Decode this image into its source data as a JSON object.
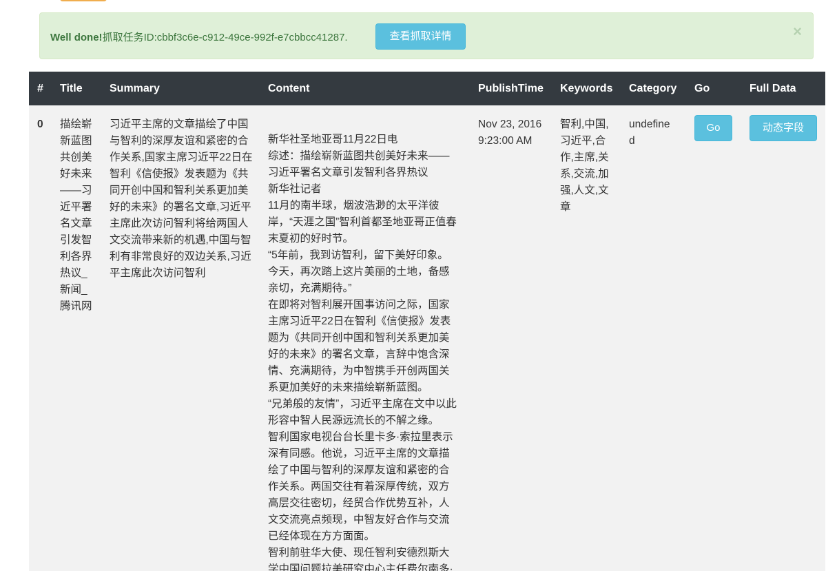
{
  "alert": {
    "strong": "Well done!",
    "message": "抓取任务ID:cbbf3c6e-c912-49ce-992f-e7cbbcc41287.",
    "button_label": "查看抓取详情",
    "close": "×"
  },
  "table": {
    "headers": [
      "#",
      "Title",
      "Summary",
      "Content",
      "PublishTime",
      "Keywords",
      "Category",
      "Go",
      "Full Data"
    ],
    "rows": [
      {
        "index": "0",
        "title": "描绘崭新蓝图共创美好未来——习近平署名文章引发智利各界热议_新闻_腾讯网",
        "summary": "习近平主席的文章描绘了中国与智利的深厚友谊和紧密的合作关系,国家主席习近平22日在智利《信使报》发表题为《共同开创中国和智利关系更加美好的未来》的署名文章,习近平主席此次访问智利将给两国人文交流带来新的机遇,中国与智利有非常良好的双边关系,习近平主席此次访问智利",
        "content": [
          "新华社圣地亚哥11月22日电",
          "综述：描绘崭新蓝图共创美好未来——习近平署名文章引发智利各界热议",
          "新华社记者",
          "11月的南半球，烟波浩渺的太平洋彼岸，“天涯之国”智利首都圣地亚哥正值春末夏初的好时节。",
          "“5年前，我到访智利，留下美好印象。今天，再次踏上这片美丽的土地，备感亲切，充满期待。”",
          "在即将对智利展开国事访问之际，国家主席习近平22日在智利《信使报》发表题为《共同开创中国和智利关系更加美好的未来》的署名文章，言辞中饱含深情、充满期待，为中智携手开创两国关系更加美好的未来描绘崭新蓝图。",
          "“兄弟般的友情”，习近平主席在文中以此形容中智人民源远流长的不解之缘。",
          "智利国家电视台台长里卡多·索拉里表示深有同感。他说，习近平主席的文章描绘了中国与智利的深厚友谊和紧密的合作关系。两国交往有着深厚传统，双方高层交往密切，经贸合作优势互补，人文交流亮点频现，中智友好合作与交流已经体现在方方面面。",
          "智利前驻华大使、现任智利安德烈斯大学中国问题拉美研究中心主任费尔南多·"
        ],
        "publish_time": "Nov 23, 2016 9:23:00 AM",
        "keywords": "智利,中国,习近平,合作,主席,关系,交流,加强,人文,文章",
        "category": "undefined",
        "go_label": "Go",
        "full_data_label": "动态字段"
      }
    ]
  }
}
